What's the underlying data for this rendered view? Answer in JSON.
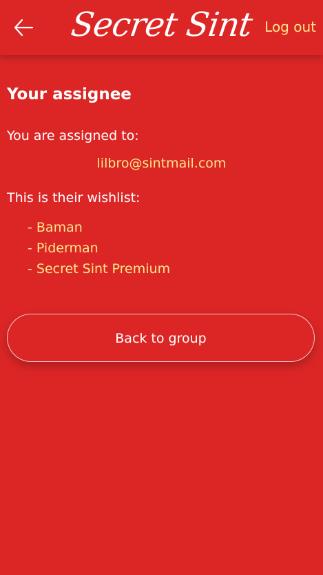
{
  "header": {
    "back_icon": "arrow-left-icon",
    "logo_text": "Secret Sint",
    "logout_label": "Log out"
  },
  "main": {
    "heading": "Your assignee",
    "assigned_label": "You are assigned to:",
    "assignee_email": "lilbro@sintmail.com",
    "wishlist_label": "This is their wishlist:",
    "wishlist": [
      "- Baman",
      "- Piderman",
      "- Secret Sint Premium"
    ],
    "back_to_group_label": "Back to group"
  },
  "colors": {
    "background": "#dc2626",
    "accent_text": "#fde68a",
    "text": "#ffffff"
  }
}
